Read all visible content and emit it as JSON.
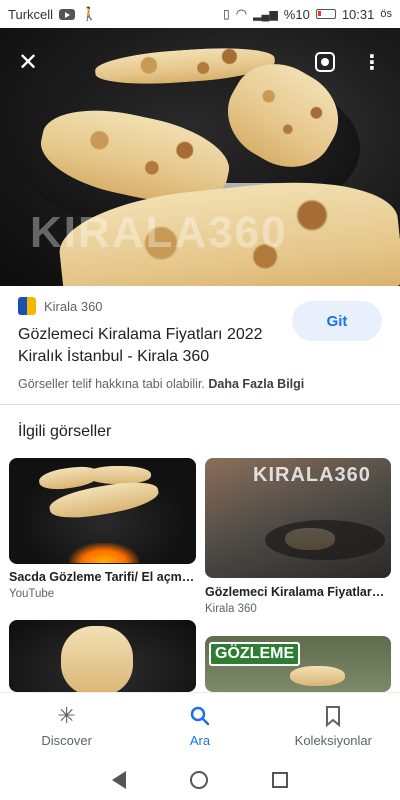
{
  "status_bar": {
    "carrier": "Turkcell",
    "battery": "%10",
    "time": "10:31",
    "time_suffix": "ös"
  },
  "hero": {
    "watermark": "KIRALA360"
  },
  "result": {
    "source_name": "Kirala 360",
    "title": "Gözlemeci Kiralama Fiyatları 2022 Kiralık İstanbul - Kirala 360",
    "go_button": "Git",
    "notice_text": "Görseller telif hakkına tabi olabilir.",
    "notice_link": "Daha Fazla Bilgi",
    "logo_colors": [
      "#1a4fb3",
      "#f5b800"
    ]
  },
  "related": {
    "heading": "İlgili görseller",
    "items": [
      {
        "title": "Sacda Gözleme Tarifi/ El açm…",
        "source": "YouTube"
      },
      {
        "title": "Gözlemeci Kiralama Fiyatları …",
        "source": "Kirala 360",
        "watermark": "KIRALA360"
      },
      {
        "title": "",
        "source": ""
      },
      {
        "title": "",
        "source": "",
        "watermark": "GÖZLEME"
      }
    ]
  },
  "bottom_nav": {
    "items": [
      {
        "label": "Discover",
        "icon": "asterisk-icon"
      },
      {
        "label": "Ara",
        "icon": "search-icon"
      },
      {
        "label": "Koleksiyonlar",
        "icon": "bookmark-icon"
      }
    ],
    "active": "Ara"
  },
  "colors": {
    "accent": "#1a73e8",
    "go_button_bg": "#e8f0fe"
  }
}
